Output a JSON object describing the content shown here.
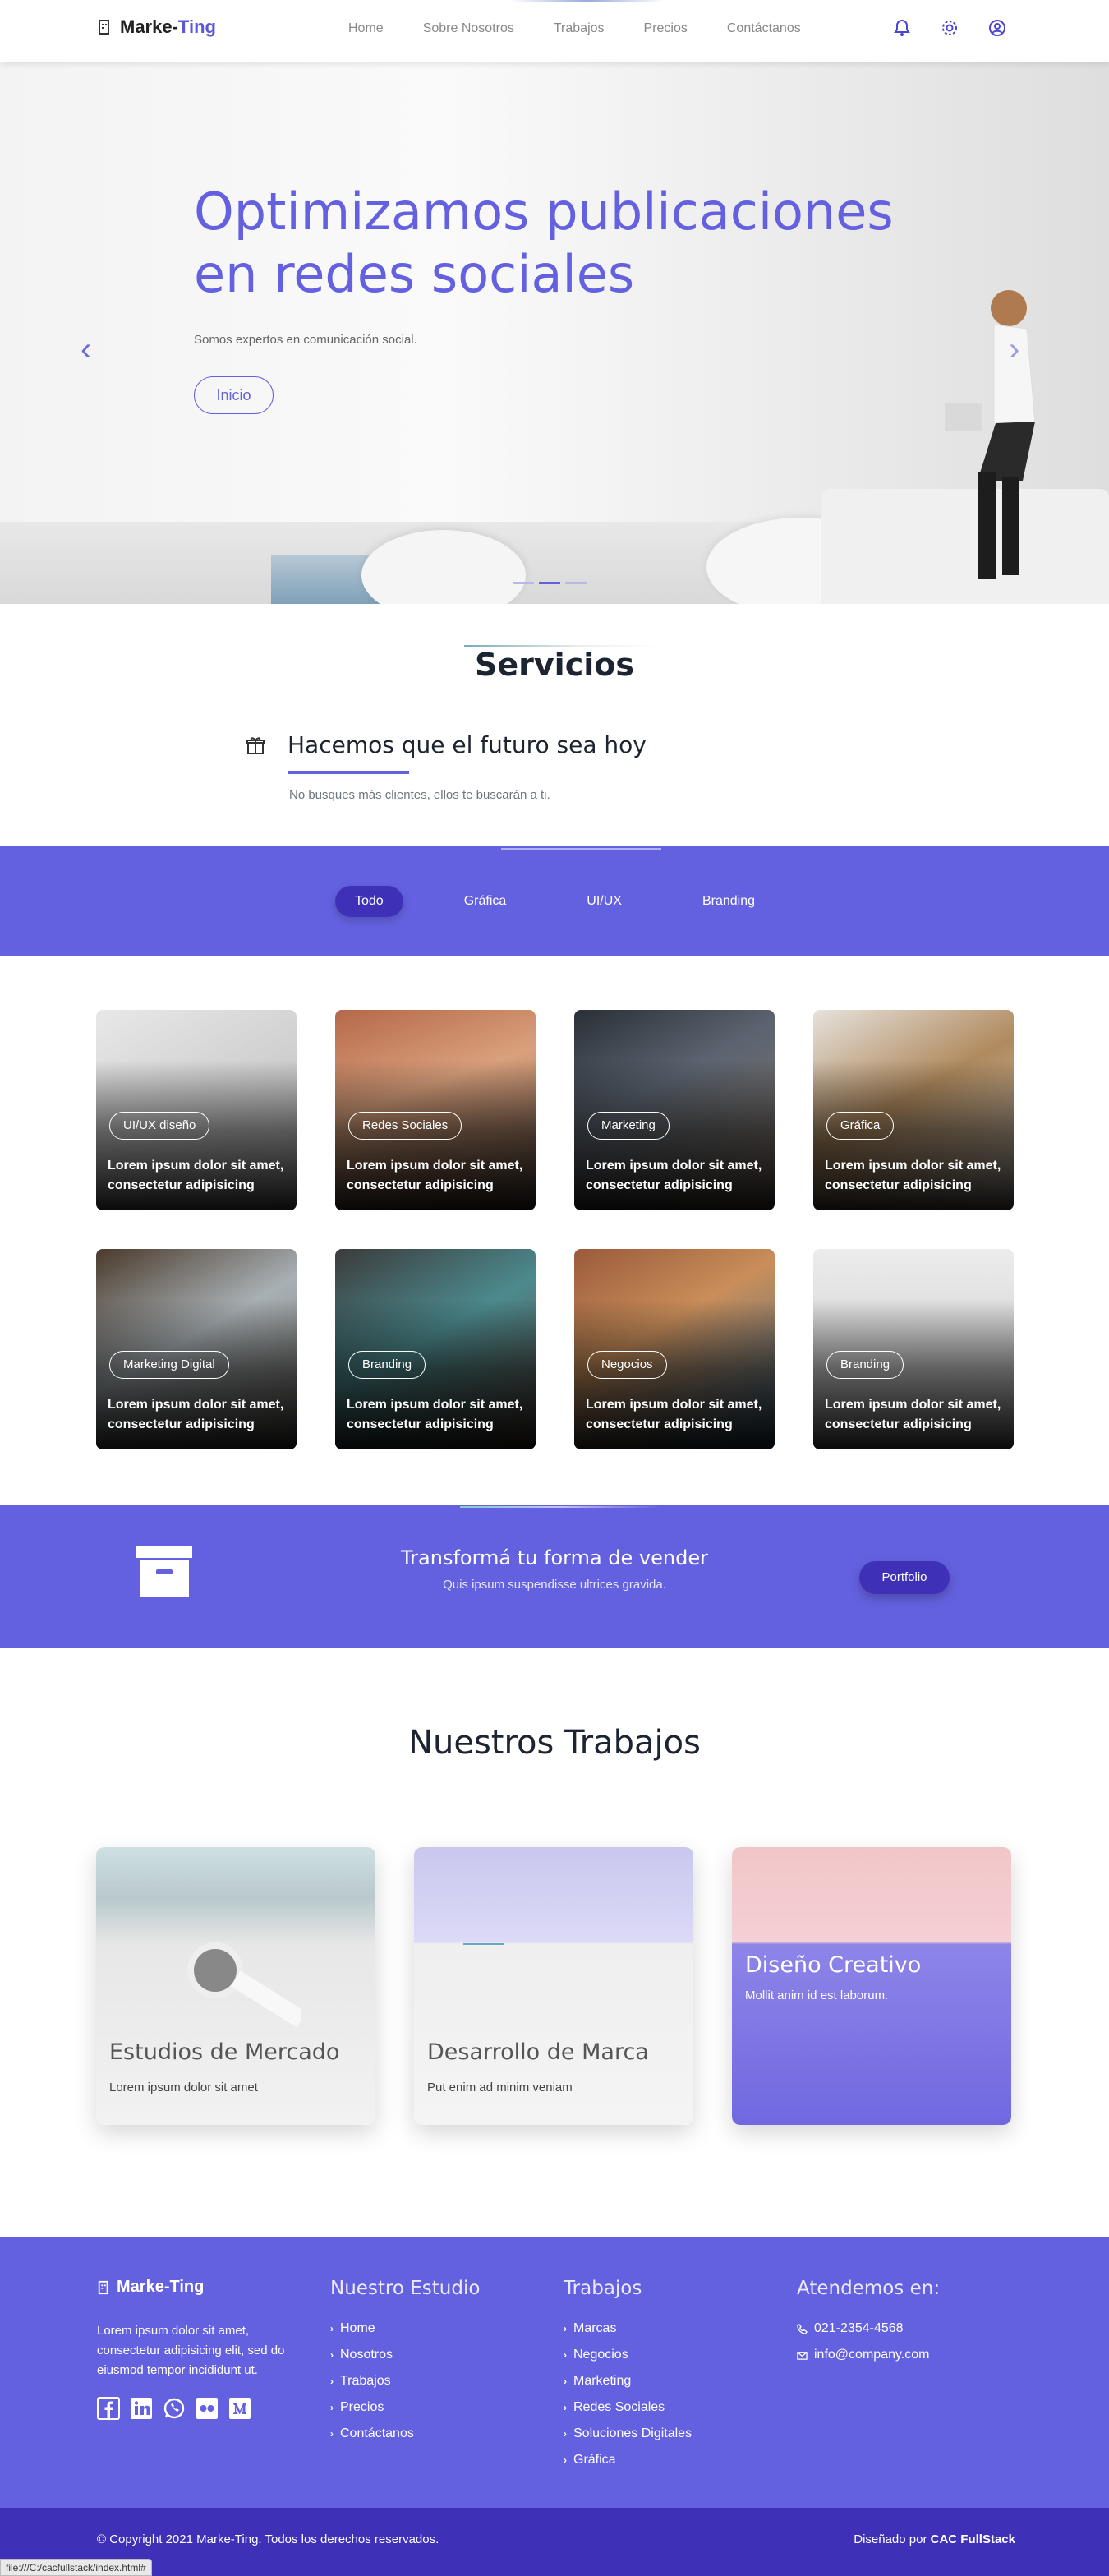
{
  "header": {
    "brand_first": "Marke-",
    "brand_second": "Ting",
    "nav": [
      "Home",
      "Sobre Nosotros",
      "Trabajos",
      "Precios",
      "Contáctanos"
    ],
    "icons": [
      "bell-icon",
      "gear-icon",
      "user-circle-icon"
    ]
  },
  "hero": {
    "title_line1": "Optimizamos publicaciones",
    "title_line2": "en redes sociales",
    "subtitle": "Somos expertos en comunicación social.",
    "button": "Inicio",
    "prev": "‹",
    "next": "›",
    "slides": 3,
    "active_slide": 2
  },
  "servicios": {
    "title": "Servicios",
    "heading": "Hacemos que el futuro sea hoy",
    "description": "No busques más clientes, ellos te buscarán a ti."
  },
  "filter": {
    "tabs": [
      "Todo",
      "Gráfica",
      "UI/UX",
      "Branding"
    ],
    "active": "Todo"
  },
  "portfolio": [
    {
      "tag": "UI/UX diseño",
      "text": "Lorem ipsum dolor sit amet, consectetur adipisicing"
    },
    {
      "tag": "Redes Sociales",
      "text": "Lorem ipsum dolor sit amet, consectetur adipisicing"
    },
    {
      "tag": "Marketing",
      "text": "Lorem ipsum dolor sit amet, consectetur adipisicing"
    },
    {
      "tag": "Gráfica",
      "text": "Lorem ipsum dolor sit amet, consectetur adipisicing"
    },
    {
      "tag": "Marketing Digital",
      "text": "Lorem ipsum dolor sit amet, consectetur adipisicing"
    },
    {
      "tag": "Branding",
      "text": "Lorem ipsum dolor sit amet, consectetur adipisicing"
    },
    {
      "tag": "Negocios",
      "text": "Lorem ipsum dolor sit amet, consectetur adipisicing"
    },
    {
      "tag": "Branding",
      "text": "Lorem ipsum dolor sit amet, consectetur adipisicing"
    }
  ],
  "cta": {
    "title": "Transformá tu forma de vender",
    "subtitle": "Quis ipsum suspendisse ultrices gravida.",
    "button": "Portfolio"
  },
  "trabajos": {
    "title": "Nuestros Trabajos",
    "items": [
      {
        "title": "Estudios de Mercado",
        "subtitle": "Lorem ipsum dolor sit amet"
      },
      {
        "title": "Desarrollo de Marca",
        "subtitle": "Put enim ad minim veniam"
      },
      {
        "title": "Diseño Creativo",
        "subtitle": "Mollit anim id est laborum."
      }
    ]
  },
  "footer": {
    "brand": "Marke-Ting",
    "about": "Lorem ipsum dolor sit amet, consectetur adipisicing elit, sed do eiusmod tempor incididunt ut.",
    "socials": [
      "facebook-icon",
      "linkedin-icon",
      "whatsapp-icon",
      "flickr-icon",
      "medium-icon"
    ],
    "col2_title": "Nuestro Estudio",
    "col2_links": [
      "Home",
      "Nosotros",
      "Trabajos",
      "Precios",
      "Contáctanos"
    ],
    "col3_title": "Trabajos",
    "col3_links": [
      "Marcas",
      "Negocios",
      "Marketing",
      "Redes Sociales",
      "Soluciones Digitales",
      "Gráfica"
    ],
    "col4_title": "Atendemos en:",
    "phone": "021-2354-4568",
    "email": "info@company.com",
    "copyright": "© Copyright 2021 Marke-Ting. Todos los derechos reservados.",
    "designed_prefix": "Diseñado por ",
    "designed_by": "CAC FullStack"
  },
  "status_bar": "file:///C:/cacfullstack/index.html#"
}
